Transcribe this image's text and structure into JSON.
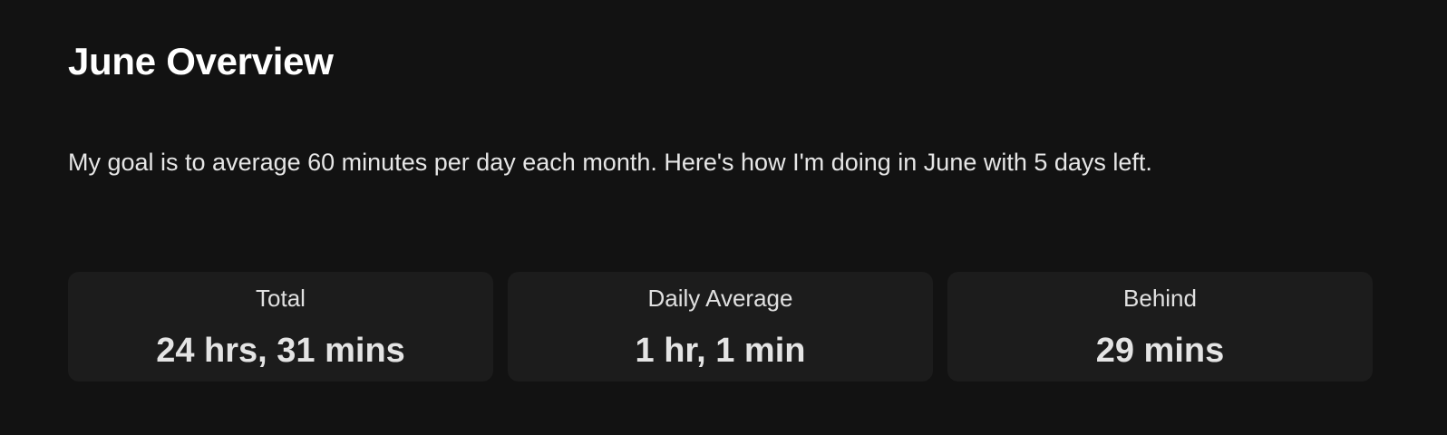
{
  "overview": {
    "title": "June Overview",
    "description": "My goal is to average 60 minutes per day each month. Here's how I'm doing in June with 5 days left."
  },
  "stats": [
    {
      "label": "Total",
      "value": "24 hrs, 31 mins"
    },
    {
      "label": "Daily Average",
      "value": "1 hr, 1 min"
    },
    {
      "label": "Behind",
      "value": "29 mins"
    }
  ],
  "colors": {
    "background": "#121212",
    "card": "#1c1c1c",
    "title": "#ffffff",
    "text": "#e2e2e2"
  }
}
